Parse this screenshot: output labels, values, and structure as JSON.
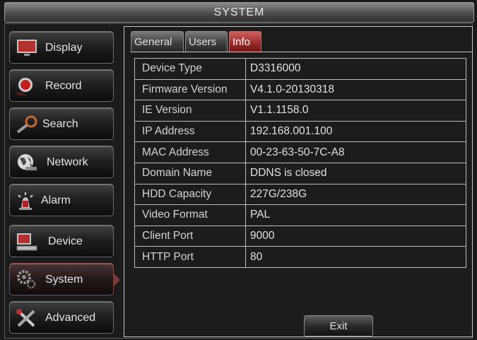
{
  "window": {
    "title": "SYSTEM"
  },
  "sidebar": {
    "items": [
      {
        "label": "Display",
        "icon": "monitor-icon",
        "active": false
      },
      {
        "label": "Record",
        "icon": "record-icon",
        "active": false
      },
      {
        "label": "Search",
        "icon": "magnifier-icon",
        "active": false
      },
      {
        "label": "Network",
        "icon": "network-globe-icon",
        "active": false
      },
      {
        "label": "Alarm",
        "icon": "alarm-siren-icon",
        "active": false
      },
      {
        "label": "Device",
        "icon": "device-hdd-icon",
        "active": false
      },
      {
        "label": "System",
        "icon": "gears-icon",
        "active": true
      },
      {
        "label": "Advanced",
        "icon": "tools-icon",
        "active": false
      }
    ]
  },
  "tabs": [
    {
      "label": "General",
      "active": false
    },
    {
      "label": "Users",
      "active": false
    },
    {
      "label": "Info",
      "active": true
    }
  ],
  "info": {
    "rows": [
      {
        "key": "Device Type",
        "value": "D3316000"
      },
      {
        "key": "Firmware Version",
        "value": "V4.1.0-20130318"
      },
      {
        "key": "IE Version",
        "value": "V1.1.1158.0"
      },
      {
        "key": "IP Address",
        "value": "192.168.001.100"
      },
      {
        "key": "MAC Address",
        "value": "00-23-63-50-7C-A8"
      },
      {
        "key": "Domain Name",
        "value": "DDNS is closed"
      },
      {
        "key": "HDD Capacity",
        "value": "227G/238G"
      },
      {
        "key": "Video Format",
        "value": "PAL"
      },
      {
        "key": "Client Port",
        "value": "9000"
      },
      {
        "key": "HTTP Port",
        "value": "80"
      }
    ]
  },
  "footer": {
    "exit_label": "Exit"
  },
  "colors": {
    "active_tab": "#9b2a2a",
    "active_sidebar_border": "#8b4b4b",
    "background": "#1a1a1a"
  }
}
